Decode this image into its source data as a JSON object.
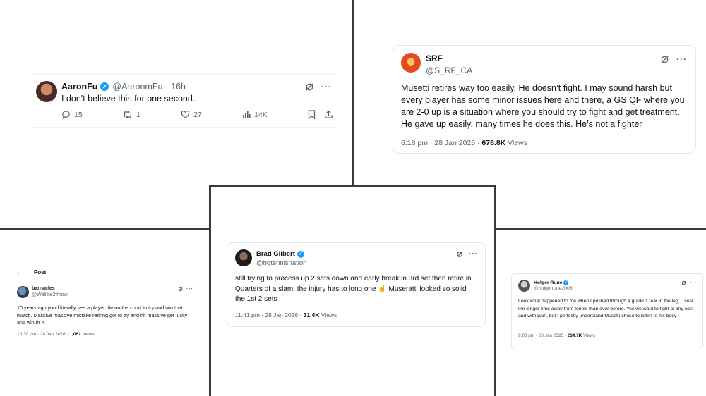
{
  "colors": {
    "text": "#0f1419",
    "muted": "#536471",
    "verified": "#1d9bf0",
    "divider": "#3a3a3a"
  },
  "icons": [
    "grok-icon",
    "more-icon",
    "reply-icon",
    "retweet-icon",
    "like-icon",
    "views-icon",
    "bookmark-icon",
    "share-icon",
    "back-arrow-icon",
    "verified-icon"
  ],
  "tweets": {
    "aaron": {
      "name": "AaronFu",
      "handle": "@AaronmFu",
      "time": "· 16h",
      "text": "I don't believe this for one second.",
      "replies": "15",
      "reposts": "1",
      "likes": "27",
      "views": "14K"
    },
    "srf": {
      "name": "SRF",
      "handle": "@S_RF_CA",
      "text": "Musetti retires way too easily. He doesn’t fight. I may sound harsh but every player has some minor issues here and there, a GS QF where you are 2-0 up is a situation where you should try to fight and get treatment. He gave up easily, many times he does this. He’s not a fighter",
      "timestamp": "6:18 pm · 28 Jan 2026 · ",
      "views": "676.8K",
      "views_label": " Views"
    },
    "barnacles": {
      "header_title": "Post",
      "name": "barnacles",
      "handle": "@Wellike2throw",
      "text": "10 years ago youd literally see a player die on the court to try and win that match. Massive massive mistake retiring got to try and hit massive get lucky and win in 4",
      "timestamp": "10:30 pm · 28 Jan 2026 · ",
      "views": "1,062",
      "views_label": " Views"
    },
    "brad": {
      "name": "Brad Gilbert",
      "handle": "@bgtennisnation",
      "text": "still trying to process up 2 sets down and early break  in 3rd set then retire  in Quarters of a slam, the injury has to long one ☝️ Museratti looked so solid the 1st 2 sets",
      "timestamp": "11:41 pm · 28 Jan 2026 · ",
      "views": "31.4K",
      "views_label": " Views"
    },
    "holger": {
      "name": "Holger Rune",
      "handle": "@holgerrune2003",
      "text": "Look what happened to me when I pushed through a grade 1 tear in the leg….cost me longer time away from tennis than ever before. Yes we want to fight at any cost and with pain, but I perfectly understand Musetti chose to listen to his body",
      "timestamp": "9:08 pm · 28 Jan 2026 · ",
      "views": "234.7K",
      "views_label": " Views"
    }
  }
}
